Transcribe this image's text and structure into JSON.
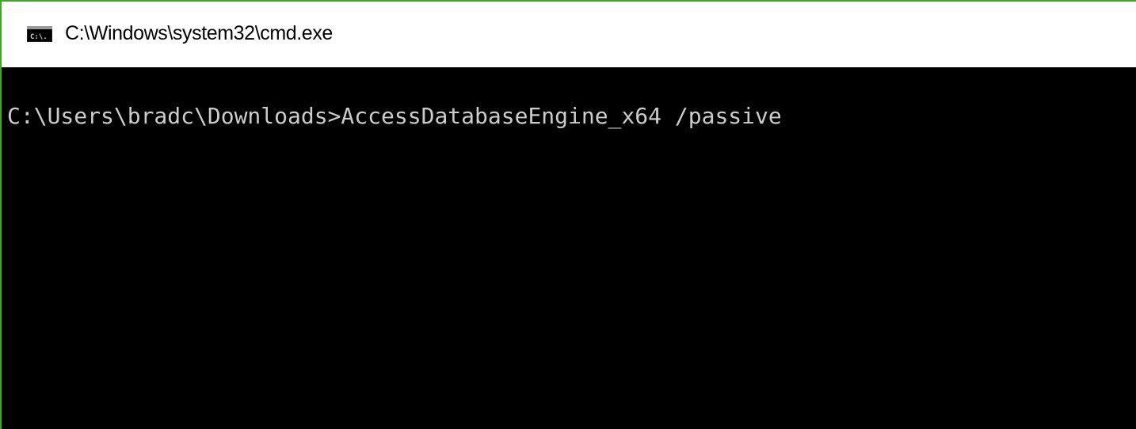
{
  "window": {
    "title": "C:\\Windows\\system32\\cmd.exe",
    "app_icon": "cmd-icon",
    "app_icon_text": "C:\\.",
    "border_color": "#4f9a3b"
  },
  "console": {
    "background": "#000000",
    "text_color": "#cccccc",
    "lines": [
      "C:\\Users\\bradc\\Downloads>AccessDatabaseEngine_x64 /passive"
    ]
  }
}
